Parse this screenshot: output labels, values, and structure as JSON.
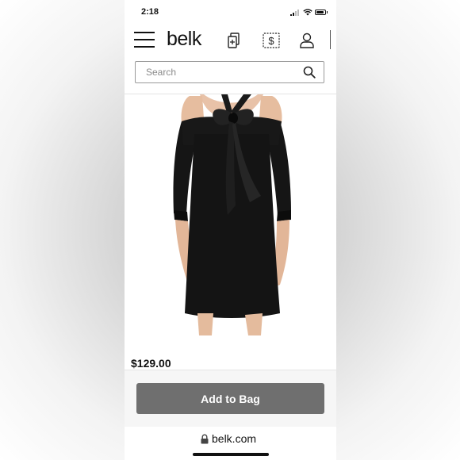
{
  "status_bar": {
    "time": "2:18"
  },
  "header": {
    "logo": "belk",
    "icons": [
      "menu-icon",
      "store-icon",
      "deals-icon",
      "account-icon"
    ]
  },
  "search": {
    "placeholder": "Search"
  },
  "product": {
    "image": "black-cold-shoulder-tie-neck-dress",
    "price": "$129.00"
  },
  "actions": {
    "add_to_bag": "Add to Bag"
  },
  "browser": {
    "url": "belk.com"
  },
  "colors": {
    "button": "#6f6f6f",
    "text": "#111111",
    "dress": "#111111"
  }
}
